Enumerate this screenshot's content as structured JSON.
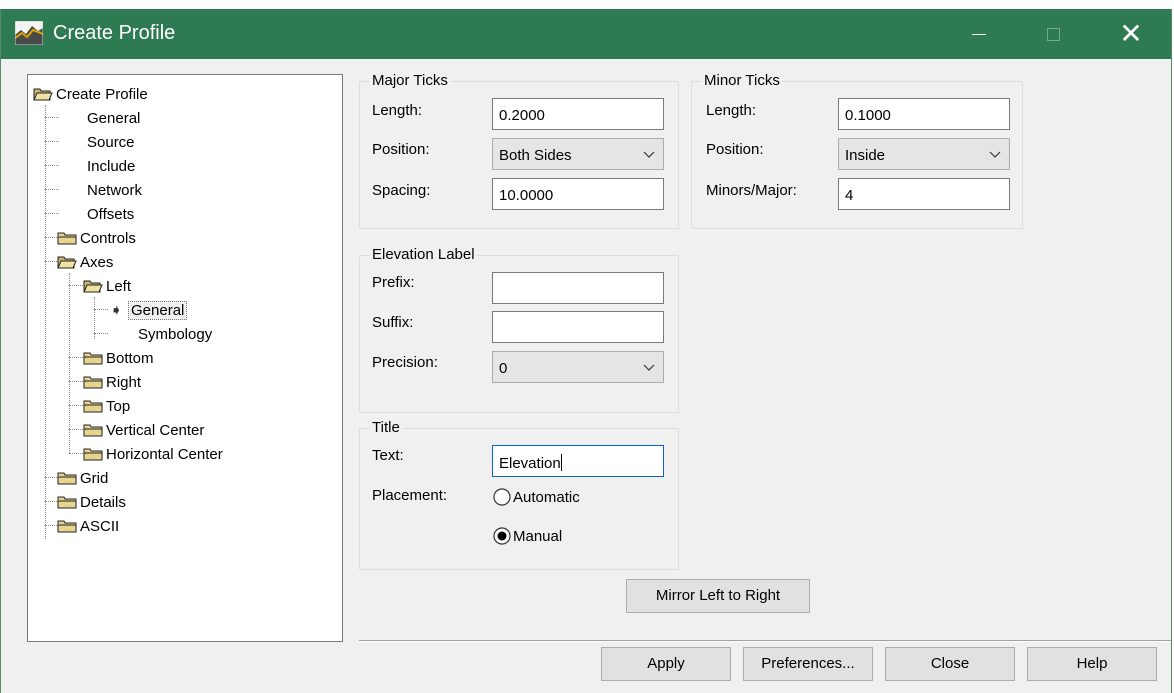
{
  "window": {
    "title": "Create Profile",
    "close_glyph": "✕",
    "icon": "profile-app-icon"
  },
  "tree": {
    "items": [
      {
        "label": "Create Profile",
        "icon": "open-folder-icon"
      },
      {
        "label": "General"
      },
      {
        "label": "Source"
      },
      {
        "label": "Include"
      },
      {
        "label": "Network"
      },
      {
        "label": "Offsets"
      },
      {
        "label": "Controls",
        "icon": "folder-icon"
      },
      {
        "label": "Axes",
        "icon": "open-folder-icon"
      },
      {
        "label": "Left",
        "icon": "open-folder-icon"
      },
      {
        "label": "General",
        "selected": true,
        "marker": "➧"
      },
      {
        "label": "Symbology"
      },
      {
        "label": "Bottom",
        "icon": "folder-icon"
      },
      {
        "label": "Right",
        "icon": "folder-icon"
      },
      {
        "label": "Top",
        "icon": "folder-icon"
      },
      {
        "label": "Vertical Center",
        "icon": "folder-icon"
      },
      {
        "label": "Horizontal Center",
        "icon": "folder-icon"
      },
      {
        "label": "Grid",
        "icon": "folder-icon"
      },
      {
        "label": "Details",
        "icon": "folder-icon"
      },
      {
        "label": "ASCII",
        "icon": "folder-icon"
      }
    ]
  },
  "major_ticks": {
    "legend": "Major Ticks",
    "length_label": "Length:",
    "length_value": "0.2000",
    "position_label": "Position:",
    "position_value": "Both Sides",
    "spacing_label": "Spacing:",
    "spacing_value": "10.0000"
  },
  "minor_ticks": {
    "legend": "Minor Ticks",
    "length_label": "Length:",
    "length_value": "0.1000",
    "position_label": "Position:",
    "position_value": "Inside",
    "minors_label": "Minors/Major:",
    "minors_value": "4"
  },
  "elevation_label": {
    "legend": "Elevation Label",
    "prefix_label": "Prefix:",
    "prefix_value": "",
    "suffix_label": "Suffix:",
    "suffix_value": "",
    "precision_label": "Precision:",
    "precision_value": "0"
  },
  "title_group": {
    "legend": "Title",
    "text_label": "Text:",
    "text_value": "Elevation",
    "placement_label": "Placement:",
    "automatic_label": "Automatic",
    "manual_label": "Manual",
    "selected": "Manual"
  },
  "buttons": {
    "mirror": "Mirror Left to Right",
    "apply": "Apply",
    "preferences": "Preferences...",
    "close": "Close",
    "help": "Help"
  },
  "colors": {
    "titlebar": "#2e7a52",
    "dialog_bg": "#f0f0f0",
    "focus_border": "#0a64c8"
  }
}
